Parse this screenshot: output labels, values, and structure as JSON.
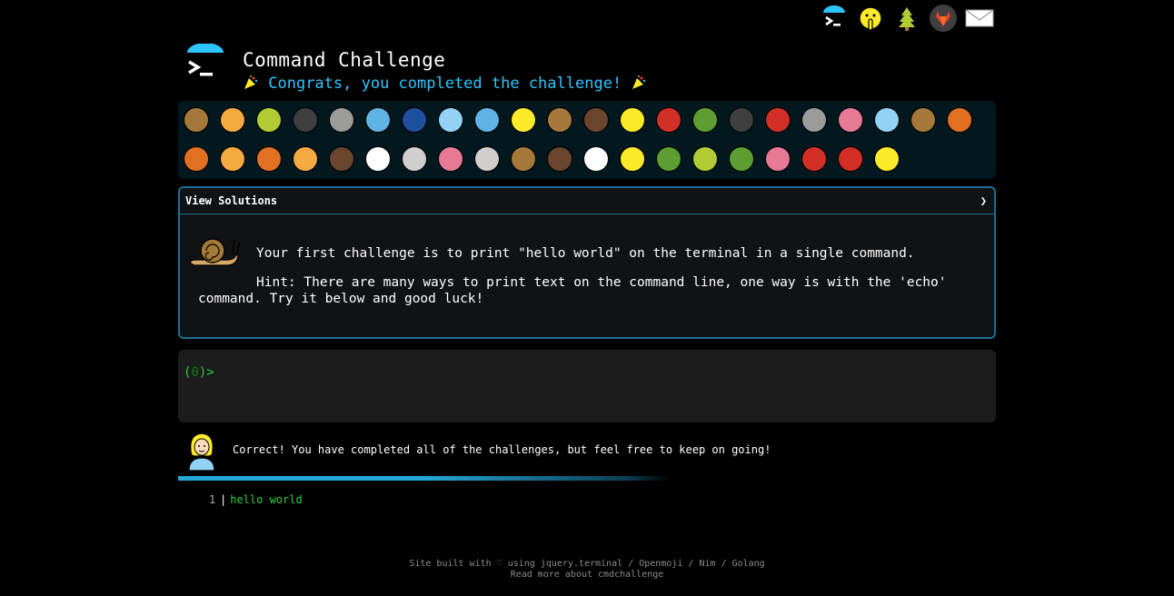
{
  "topbar": {
    "icons": [
      "terminal-icon",
      "shush-face-icon",
      "evergreen-tree-icon",
      "gitlab-icon",
      "envelope-icon"
    ]
  },
  "header": {
    "title": "Command Challenge",
    "subtitle": "Congrats, you completed the challenge!",
    "accent": "#2ec5ff"
  },
  "badges": {
    "row1": [
      "snail",
      "butterfly",
      "caterpillar",
      "ant",
      "spider-web",
      "whale",
      "dolphin",
      "shark",
      "fish",
      "tropical-fish",
      "blowfish",
      "wolf",
      "honeybee",
      "lady-beetle",
      "cricket",
      "spider",
      "scorpion",
      "fly",
      "worm",
      "microbe",
      "monkey-face",
      "dog-face"
    ],
    "row2": [
      "fox",
      "cat-face",
      "lion",
      "tiger-face",
      "horse-face",
      "unicorn",
      "cow-face",
      "pig-face",
      "mouse-face",
      "hamster",
      "bear",
      "panda",
      "hatching-chick",
      "peacock",
      "frog",
      "dragon-face",
      "cherry-blossom",
      "rose",
      "hibiscus",
      "sunflower"
    ]
  },
  "solutions": {
    "label": "View Solutions",
    "chevron": "❯"
  },
  "challenge": {
    "text": "Your first challenge is to print \"hello world\" on the terminal in a single command.",
    "hint": "Hint: There are many ways to print text on the command line, one way is with the 'echo' command. Try it below and good luck!"
  },
  "terminal": {
    "prompt_open": "(",
    "prompt_count": "0",
    "prompt_close": ")>"
  },
  "result": {
    "message": "Correct! You have completed all of the challenges, but feel free to keep on going!",
    "progress": 1.0
  },
  "history": {
    "line": "1",
    "sep": "|",
    "command": "hello world"
  },
  "footer": {
    "line1": "Site built with ♡ using jquery.terminal / Openmoji / Nim / Golang",
    "line2": "Read more about cmdchallenge"
  }
}
